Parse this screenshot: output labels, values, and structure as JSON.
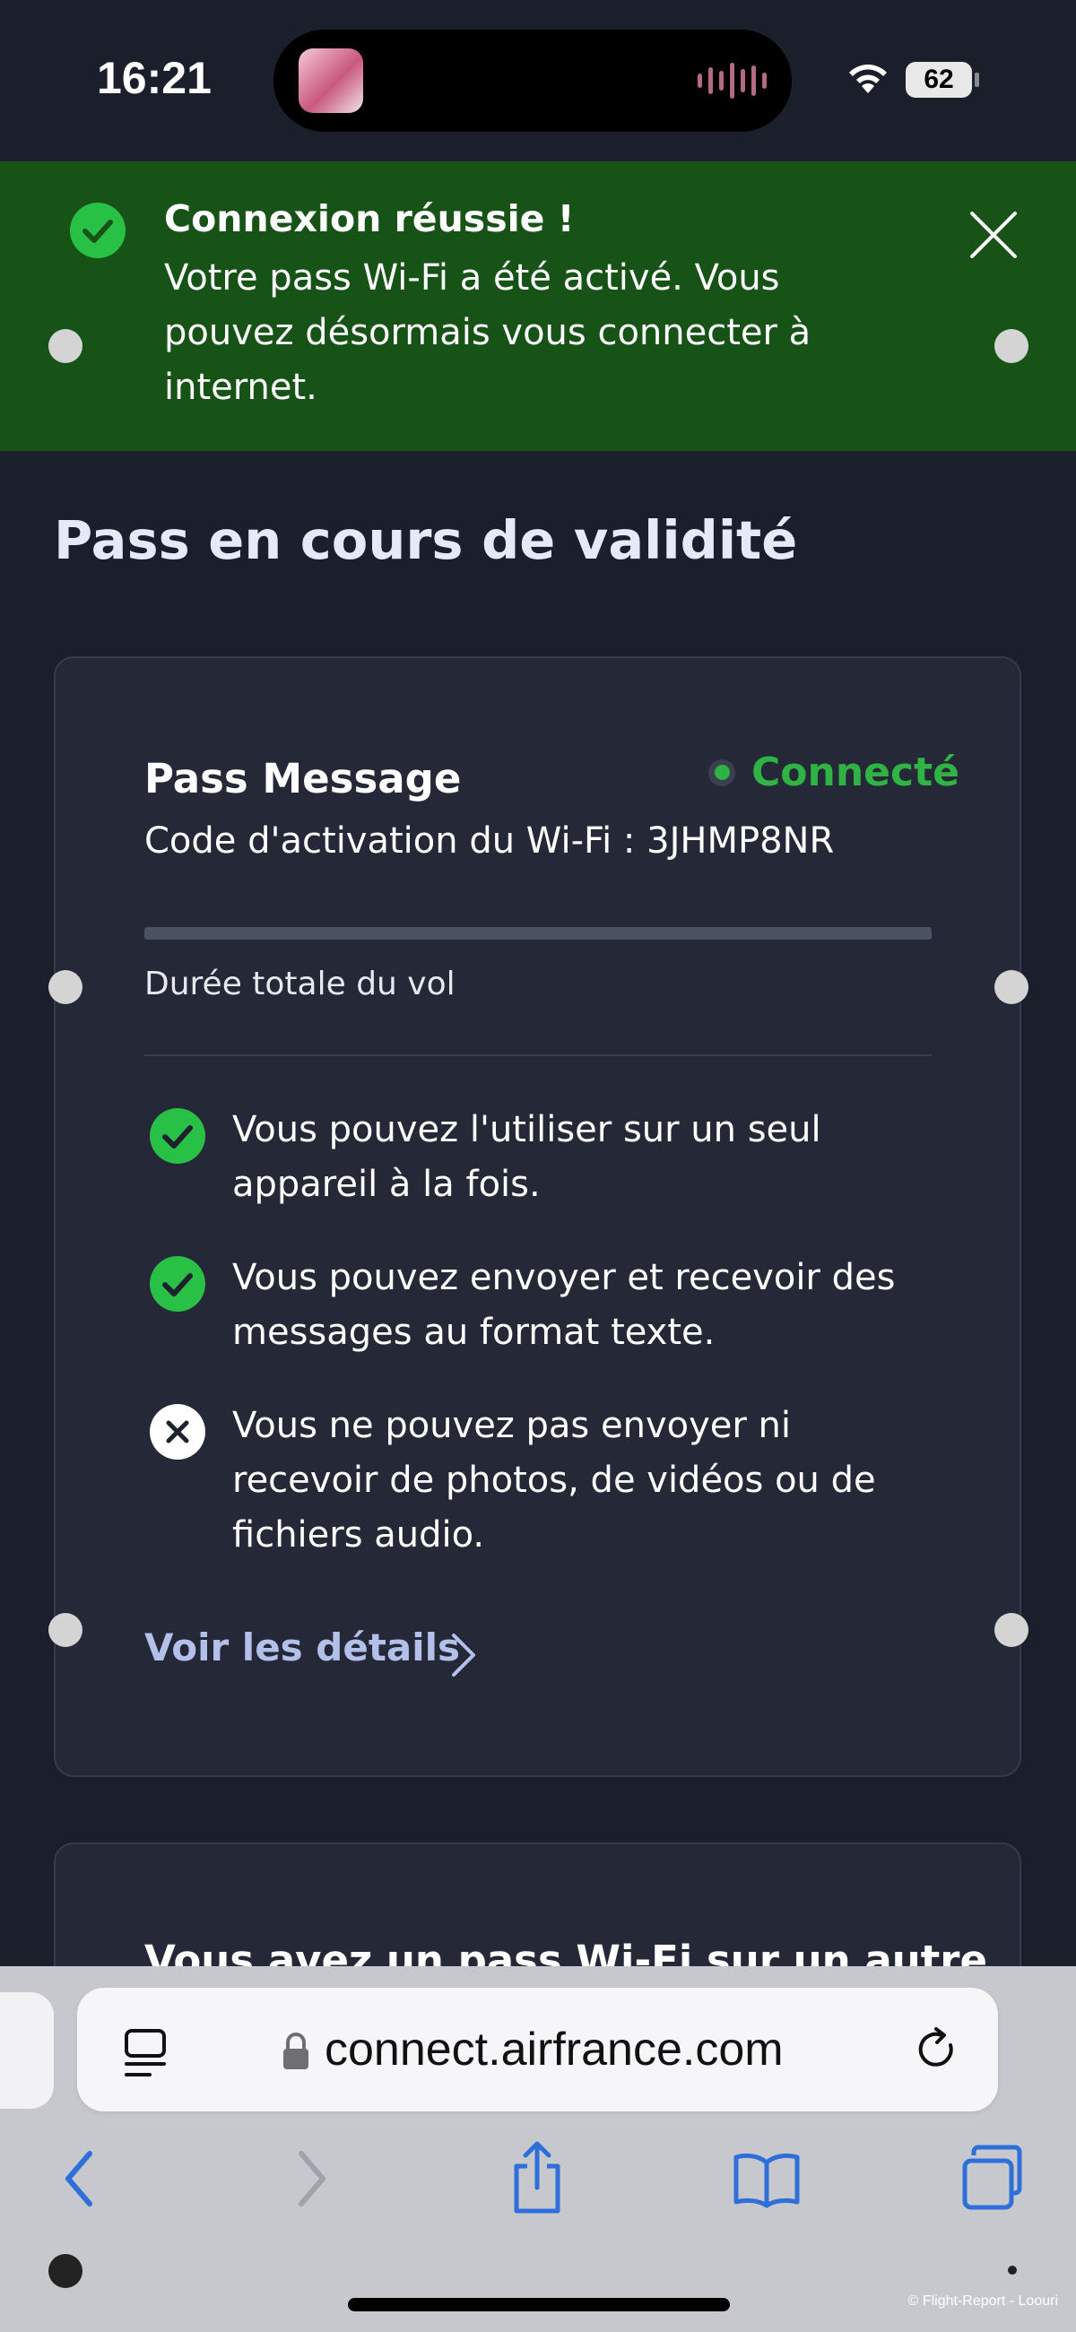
{
  "status_bar": {
    "time": "16:21",
    "battery": "62"
  },
  "banner": {
    "title": "Connexion réussie !",
    "text": "Votre pass Wi-Fi a été activé. Vous pouvez désormais vous connecter à internet.",
    "icon": "check-circle-icon",
    "close_icon": "close-icon"
  },
  "page": {
    "section_title": "Pass en cours de validité"
  },
  "pass": {
    "name": "Pass Message",
    "status": "Connecté",
    "code_line": "Code d'activation du Wi-Fi : 3JHMP8NR",
    "progress": 0,
    "duration_label": "Durée totale du vol",
    "features": [
      {
        "allowed": true,
        "text": "Vous pouvez l'utiliser sur un seul appareil à la fois."
      },
      {
        "allowed": true,
        "text": "Vous pouvez envoyer et recevoir des messages au format texte."
      },
      {
        "allowed": false,
        "text": "Vous ne pouvez pas envoyer ni recevoir de photos, de vidéos ou de fichiers audio."
      }
    ],
    "details_link": "Voir les détails"
  },
  "next_card": {
    "title": "Vous avez un pass Wi-Fi sur un autre"
  },
  "browser": {
    "url": "connect.airfrance.com"
  },
  "credit": "© Flight-Report - Loouri",
  "colors": {
    "background": "#1b1e2b",
    "banner": "#175317",
    "success": "#29c145",
    "connected": "#2fb344",
    "link": "#b3c1ea",
    "browser_accent": "#2e6fd9"
  }
}
